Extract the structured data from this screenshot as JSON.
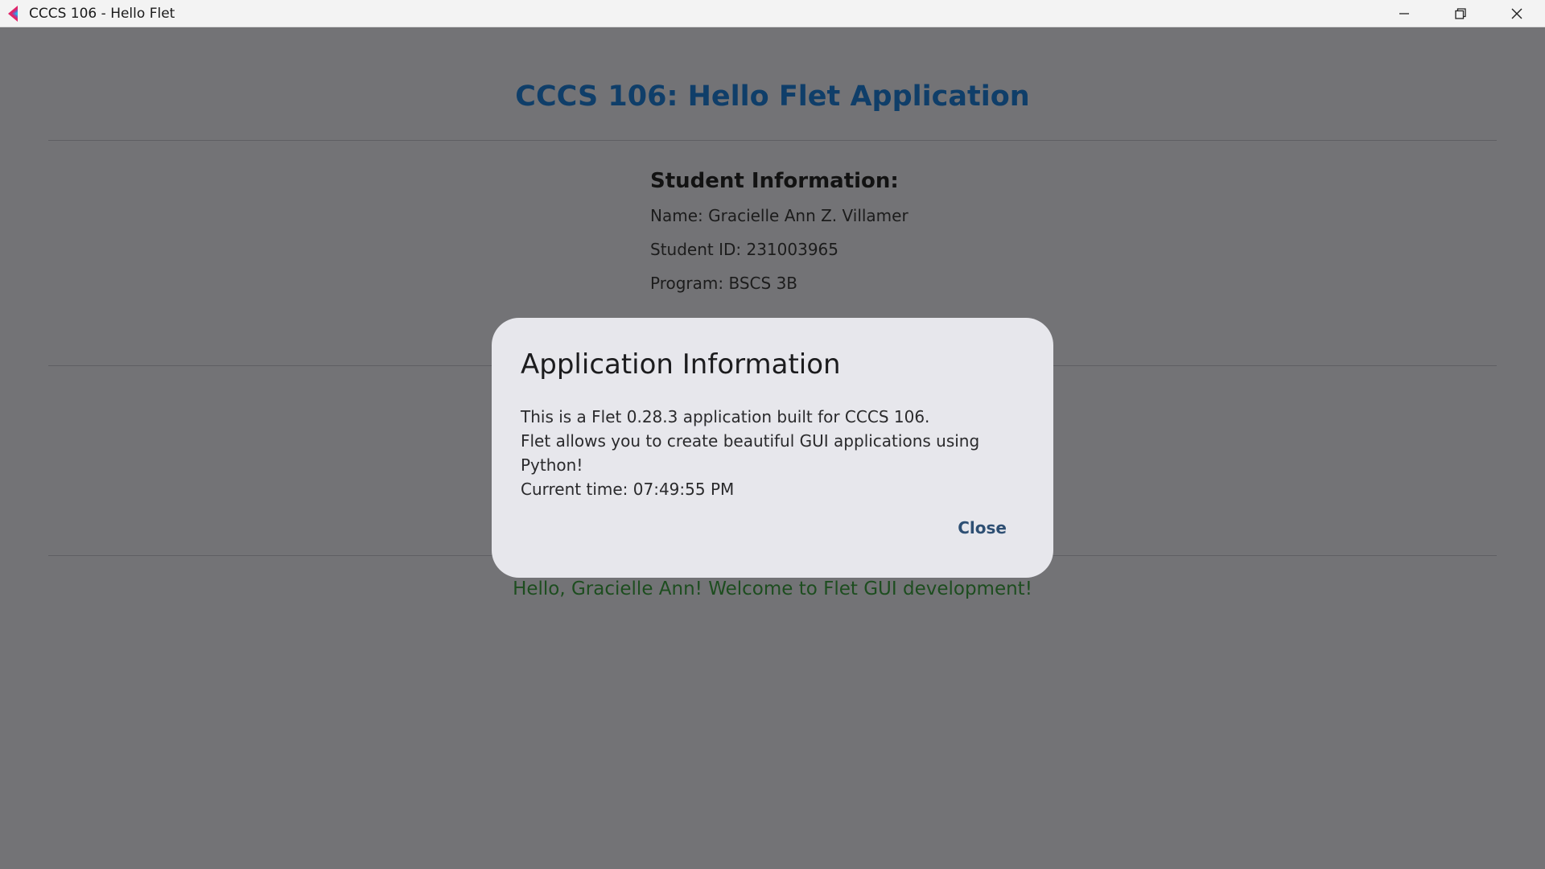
{
  "window": {
    "title": "CCCS 106 - Hello Flet",
    "controls": [
      "minimize-icon",
      "restore-icon",
      "close-icon"
    ]
  },
  "app": {
    "title": "CCCS 106: Hello Flet Application",
    "student_info": {
      "heading": "Student Information:",
      "name": "Name: Gracielle Ann Z. Villamer",
      "student_id": "Student ID: 231003965",
      "program": "Program: BSCS 3B"
    },
    "greeting": "Hello, Gracielle Ann! Welcome to Flet GUI development!"
  },
  "dialog": {
    "title": "Application Information",
    "lines": [
      "This is a Flet 0.28.3 application built for CCCS 106.",
      "Flet allows you to create beautiful GUI applications using Python!",
      "Current time: 07:49:55 PM"
    ],
    "close_label": "Close"
  },
  "colors": {
    "overlay_background": "#737376",
    "title_color": "#0f3e69",
    "greeting_color": "#1d4d1f",
    "dialog_background": "#e7e7ec",
    "accent": "#2e4f73"
  }
}
